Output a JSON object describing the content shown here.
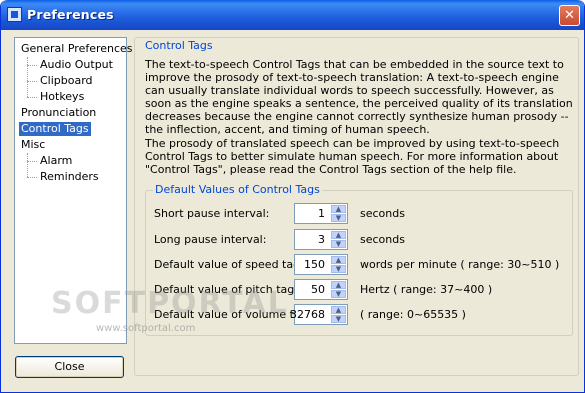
{
  "window": {
    "title": "Preferences",
    "close_glyph": "✕"
  },
  "tree": {
    "items": [
      {
        "label": "General Preferences",
        "selected": false
      },
      {
        "label": "Audio Output",
        "selected": false
      },
      {
        "label": "Clipboard",
        "selected": false
      },
      {
        "label": "Hotkeys",
        "selected": false
      },
      {
        "label": "Pronunciation",
        "selected": false
      },
      {
        "label": "Control Tags",
        "selected": true
      },
      {
        "label": "Misc",
        "selected": false
      },
      {
        "label": "Alarm",
        "selected": false
      },
      {
        "label": "Reminders",
        "selected": false
      }
    ]
  },
  "close_button": {
    "label": "Close"
  },
  "panel": {
    "title": "Control Tags",
    "para1": "The text-to-speech Control Tags that can be embedded in the source text to improve the prosody of text-to-speech translation: A text-to-speech engine can usually translate individual words to speech successfully. However, as soon as the engine speaks a sentence, the perceived quality of its translation decreases because the engine cannot correctly synthesize human prosody -- the inflection, accent, and timing of human speech.",
    "para2": "The prosody of translated speech can be improved by using text-to-speech Control Tags to better simulate human speech. For more information about \"Control Tags\", please read the Control Tags section of the help file.",
    "group": {
      "title": "Default Values of Control Tags",
      "rows": [
        {
          "label": "Short pause interval:",
          "value": "1",
          "unit": "seconds"
        },
        {
          "label": "Long pause interval:",
          "value": "3",
          "unit": "seconds"
        },
        {
          "label": "Default value of speed tag:",
          "value": "150",
          "unit": "words per minute ( range: 30~510 )"
        },
        {
          "label": "Default value of pitch tag:",
          "value": "50",
          "unit": "Hertz ( range: 37~400 )"
        },
        {
          "label": "Default value of volume tag:",
          "value": "32768",
          "unit": "( range: 0~65535 )"
        }
      ]
    }
  },
  "watermark": {
    "text": "SOFTPORTAL",
    "sub": "www.softportal.com"
  },
  "colors": {
    "title_bar": "#1a57d6",
    "selection": "#316ac5",
    "group_title": "#0046d5"
  }
}
